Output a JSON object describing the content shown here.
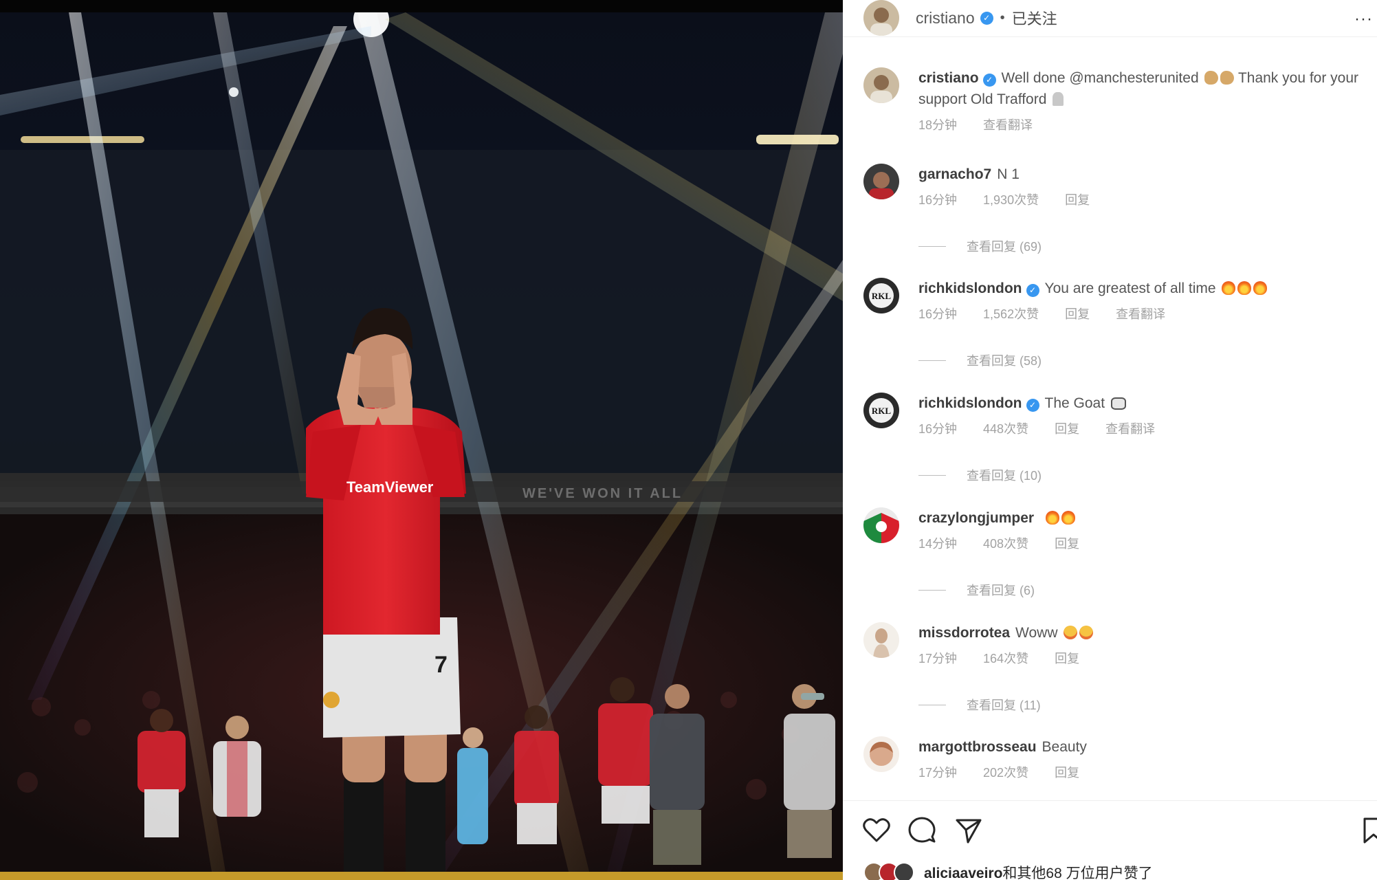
{
  "post": {
    "author": "cristiano",
    "follow_status": "已关注",
    "more_glyph": "···"
  },
  "photo": {
    "jersey_sponsor": "TeamViewer",
    "shirt_number": "7",
    "banner_text": "WE'VE WON IT ALL"
  },
  "comments": [
    {
      "user": "cristiano",
      "text": "Well done @manchesterunited",
      "text_after": "Thank you for your support Old Trafford",
      "emoji_after_text": [
        "muscle",
        "muscle"
      ],
      "emoji_end": [
        "pray"
      ],
      "time": "18分钟",
      "likes": "",
      "reply_label": "",
      "translate_label": "查看翻译",
      "view_replies": ""
    },
    {
      "user": "garnacho7",
      "text": "N 1",
      "time": "16分钟",
      "likes": "1,930次赞",
      "reply_label": "回复",
      "translate_label": "",
      "view_replies": "查看回复 (69)"
    },
    {
      "user": "richkidslondon",
      "verified": true,
      "text": "You are greatest of all time",
      "emoji_end": [
        "fire",
        "fire",
        "fire"
      ],
      "time": "16分钟",
      "likes": "1,562次赞",
      "reply_label": "回复",
      "translate_label": "查看翻译",
      "view_replies": "查看回复 (58)"
    },
    {
      "user": "richkidslondon",
      "verified": true,
      "text": "The Goat",
      "emoji_end": [
        "goat"
      ],
      "time": "16分钟",
      "likes": "448次赞",
      "reply_label": "回复",
      "translate_label": "查看翻译",
      "view_replies": "查看回复 (10)"
    },
    {
      "user": "crazylongjumper",
      "text": "",
      "emoji_end": [
        "fire",
        "fire"
      ],
      "time": "14分钟",
      "likes": "408次赞",
      "reply_label": "回复",
      "translate_label": "",
      "view_replies": "查看回复 (6)"
    },
    {
      "user": "missdorrotea",
      "text": "Woww",
      "emoji_end": [
        "love",
        "love"
      ],
      "time": "17分钟",
      "likes": "164次赞",
      "reply_label": "回复",
      "translate_label": "",
      "view_replies": "查看回复 (11)"
    },
    {
      "user": "margottbrosseau",
      "text": "Beauty",
      "time": "17分钟",
      "likes": "202次赞",
      "reply_label": "回复",
      "translate_label": "",
      "view_replies": ""
    }
  ],
  "likes_row": {
    "user": "aliciaaveiro",
    "text": "和其他68 万位用户赞了"
  },
  "colors": {
    "verified_blue": "#3897f0",
    "jersey_red": "#d8202c",
    "meta_gray": "#a2a2a2"
  },
  "icons": {
    "like": "heart-icon",
    "comment": "speech-bubble-icon",
    "share": "paper-plane-icon",
    "save": "bookmark-icon",
    "verified": "verified-badge-icon"
  }
}
